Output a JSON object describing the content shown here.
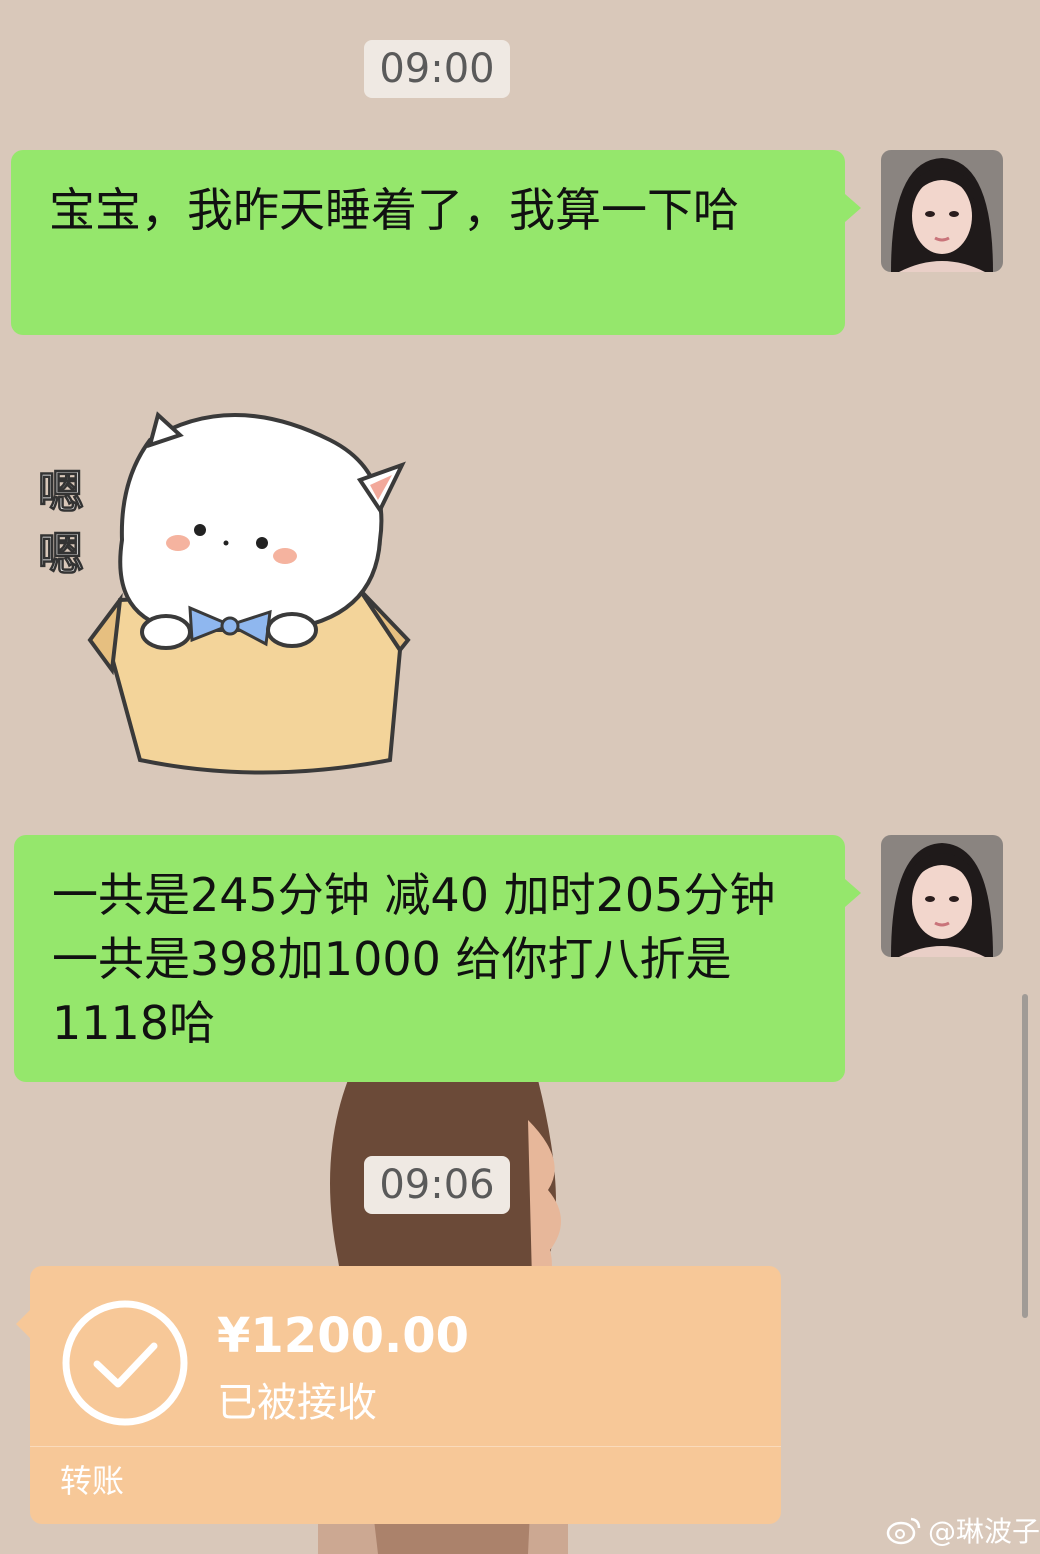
{
  "timestamps": [
    "09:00",
    "09:06"
  ],
  "messages": [
    {
      "text": "宝宝，我昨天睡着了，我算一下哈"
    },
    {
      "text": "一共是245分钟 减40 加时205分钟 一共是398加1000  给你打八折是1118哈"
    }
  ],
  "sticker": {
    "text": "嗯嗯"
  },
  "transfer": {
    "amount": "¥1200.00",
    "status": "已被接收",
    "kind": "转账"
  },
  "watermark": {
    "icon": "weibo-icon",
    "text": "@琳波子"
  },
  "colors": {
    "chat_background": "#d9c8ba",
    "sent_bubble": "#95e76c",
    "transfer_card": "#f7c898",
    "timestamp_pill": "#efe9e3"
  }
}
